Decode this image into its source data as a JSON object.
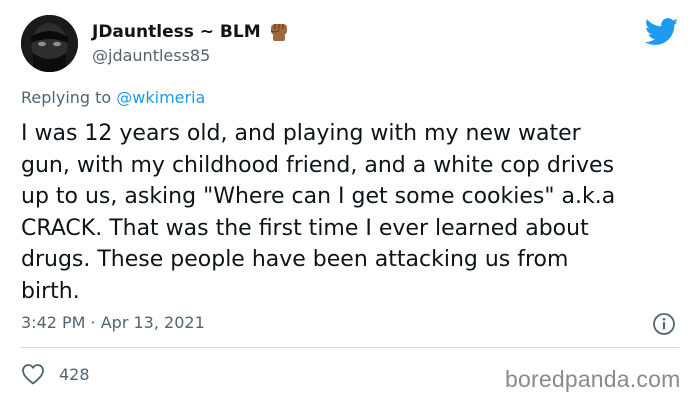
{
  "tweet": {
    "author_name": "JDauntless ~ BLM",
    "author_emoji_icon": "raised-fist-emoji",
    "handle": "@jdauntless85",
    "reply_prefix": "Replying to",
    "reply_to": "@wkimeria",
    "text": "I was 12 years old, and playing with my new water\ngun, with my childhood friend, and a white cop drives\nup to us, asking \"Where can I get some cookies\" a.k.a\nCRACK. That was the first time I ever learned about\ndrugs. These people have been attacking us from\nbirth.",
    "timestamp": "3:42 PM · Apr 13, 2021",
    "like_count": "428"
  },
  "icons": {
    "brand": "twitter-bird-icon",
    "info": "info-icon",
    "like": "heart-icon"
  },
  "colors": {
    "twitter_blue": "#1d9bf0",
    "secondary_text": "#536471",
    "divider": "#cfd9de",
    "watermark": "#8a8a8a"
  },
  "watermark": "boredpanda.com"
}
